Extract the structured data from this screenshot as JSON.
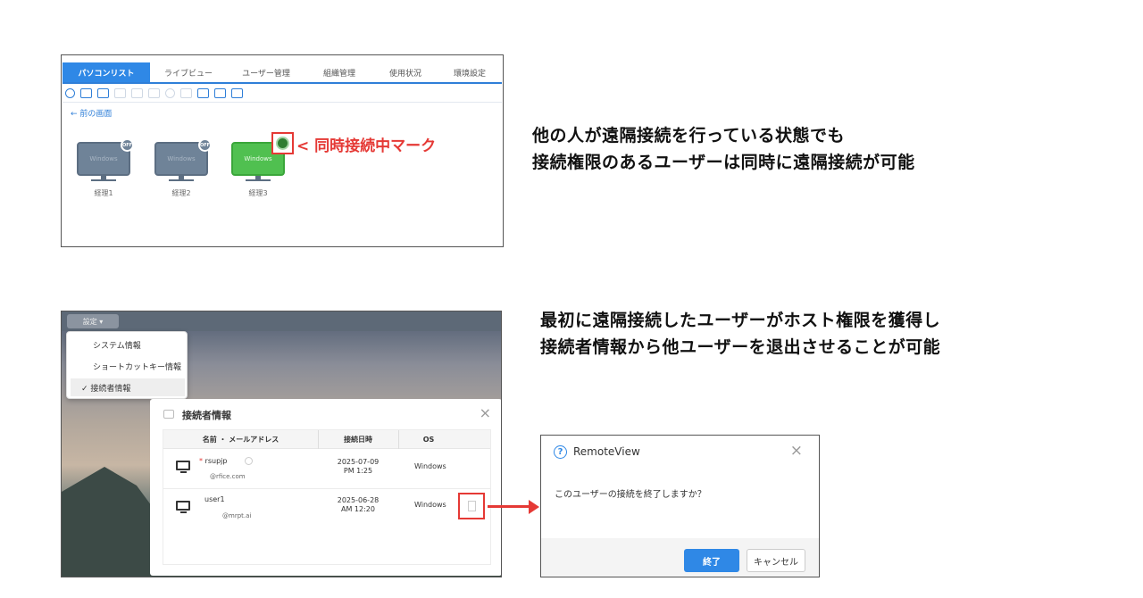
{
  "panel1": {
    "tabs": [
      "パソコンリスト",
      "ライブビュー",
      "ユーザー管理",
      "組織管理",
      "使用状況",
      "環境設定"
    ],
    "back_link": "← 前の画面",
    "pcs": [
      {
        "name": "経理1",
        "screen_label": "Windows",
        "status_badge": "OFF",
        "state": "off"
      },
      {
        "name": "経理2",
        "screen_label": "Windows",
        "status_badge": "OFF",
        "state": "off"
      },
      {
        "name": "経理3",
        "screen_label": "Windows",
        "status_badge": "",
        "state": "on"
      }
    ],
    "concurrent_mark_label": "< 同時接続中マーク"
  },
  "heading1": {
    "line1": "他の人が遠隔接続を行っている状態でも",
    "line2": "接続権限のあるユーザーは同時に遠隔接続が可能"
  },
  "heading2": {
    "line1": "最初に遠隔接続したユーザーがホスト権限を獲得し",
    "line2": "接続者情報から他ユーザーを退出させることが可能"
  },
  "panel2": {
    "menu_button": "設定 ▾",
    "dropdown_items": [
      "システム情報",
      "ショートカットキー情報",
      "✓ 接続者情報"
    ],
    "dialog": {
      "title": "接続者情報",
      "columns": [
        "名前 ・ メールアドレス",
        "接続日時",
        "OS"
      ],
      "rows": [
        {
          "name": "rsupjp",
          "marker": "*",
          "email": "@rfice.com",
          "date": "2025-07-09",
          "time": "PM 1:25",
          "os": "Windows"
        },
        {
          "name": "user1",
          "marker": "",
          "email": "@mrpt.ai",
          "date": "2025-06-28",
          "time": "AM 12:20",
          "os": "Windows"
        }
      ]
    }
  },
  "confirm": {
    "title": "RemoteView",
    "message": "このユーザーの接続を終了しますか？",
    "ok_label": "終了",
    "cancel_label": "キャンセル"
  },
  "colors": {
    "accent_blue": "#2f88e6",
    "highlight_red": "#e53935",
    "pc_on_green": "#50c050",
    "pc_off_gray": "#6f8398"
  }
}
